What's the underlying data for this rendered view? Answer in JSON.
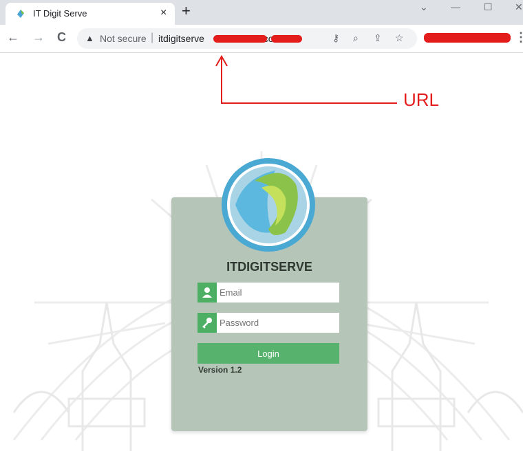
{
  "browser": {
    "tab": {
      "title": "IT Digit Serve",
      "close": "×"
    },
    "new_tab": "+",
    "window_controls": {
      "minimize": "—",
      "maximize": "☐",
      "close": "✕"
    },
    "nav": {
      "back": "←",
      "forward": "→",
      "reload": "C"
    },
    "omnibox": {
      "warning_icon": "▲",
      "security_label": "Not secure",
      "separator": "|",
      "url_visible": "itdigitserve",
      "url_suffix": ".com",
      "icons": [
        "key-icon",
        "zoom-icon",
        "share-icon",
        "star-icon"
      ]
    },
    "menu": "⋮"
  },
  "annotation": {
    "label": "URL",
    "color": "#e31c1c"
  },
  "login": {
    "title": "ITDIGITSERVE",
    "email_placeholder": "Email",
    "password_placeholder": "Password",
    "button_label": "Login",
    "version": "Version 1.2"
  },
  "colors": {
    "card_bg": "#b5c6b9",
    "accent_green": "#4caf64",
    "redaction": "#e31c1c"
  }
}
